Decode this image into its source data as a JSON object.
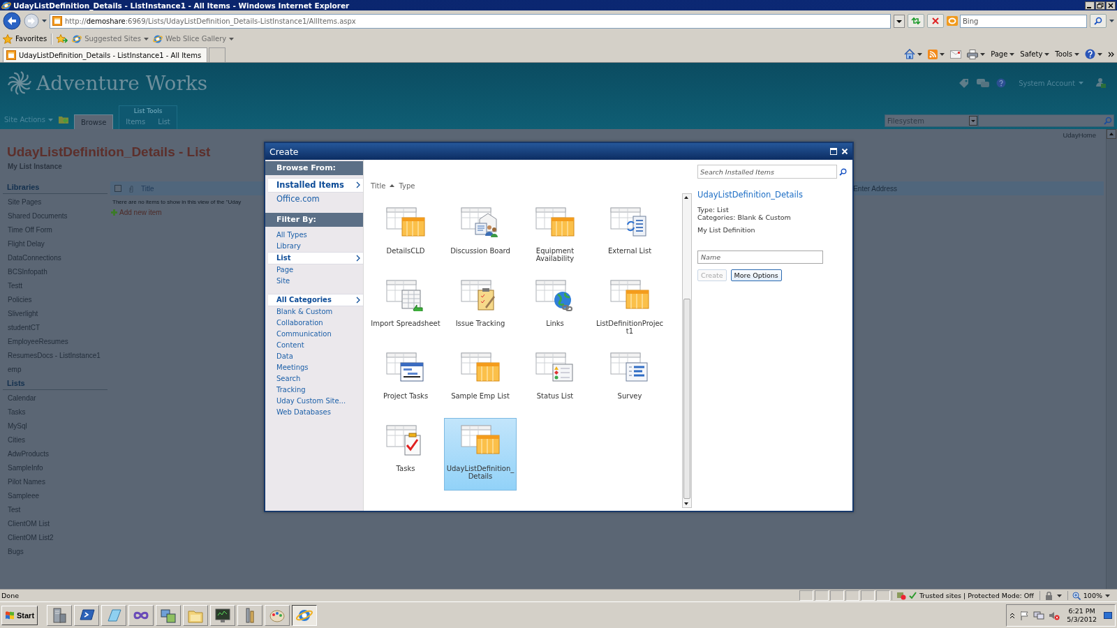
{
  "window": {
    "title": "UdayListDefinition_Details - ListInstance1 - All Items - Windows Internet Explorer"
  },
  "address_bar": {
    "url": "http://**demoshare**:6969/Lists/UdayListDefinition_Details-ListInstance1/AllItems.aspx",
    "search_placeholder": "Bing"
  },
  "favorites_bar": {
    "favorites": "Favorites",
    "links": [
      "Suggested Sites",
      "Web Slice Gallery"
    ]
  },
  "tabs": [
    {
      "label": "UdayListDefinition_Details - ListInstance1 - All Items",
      "selected": true
    }
  ],
  "command_bar": [
    "Page",
    "Safety",
    "Tools"
  ],
  "site": {
    "title": "Adventure Works",
    "user": "System Account",
    "search_scope": "Filesystem",
    "breadcrumb": "UdayHome"
  },
  "ribbon": {
    "site_actions": "Site Actions",
    "group_label": "List Tools",
    "tabs": [
      {
        "label": "Browse",
        "selected": true
      },
      {
        "label": "Items",
        "selected": false
      },
      {
        "label": "List",
        "selected": false
      }
    ]
  },
  "page": {
    "title": "UdayListDefinition_Details - List",
    "subtitle": "My List Instance"
  },
  "quick_launch": [
    {
      "heading": "Libraries",
      "items": [
        "Site Pages",
        "Shared Documents",
        "Time Off Form",
        "Flight Delay",
        "DataConnections",
        "BCSInfopath",
        "Testt",
        "Policies",
        "Sliverlight",
        "studentCT",
        "EmployeeResumes",
        "ResumesDocs - ListInstance1",
        "emp"
      ]
    },
    {
      "heading": "Lists",
      "items": [
        "Calendar",
        "Tasks",
        "MySql",
        "Cities",
        "AdwProducts",
        "SampleInfo",
        "Pilot Names",
        "Sampleee",
        "Test",
        "ClientOM List",
        "ClientOM List2",
        "Bugs"
      ]
    }
  ],
  "list_view": {
    "select_all": {
      "checked": false
    },
    "columns": [
      "Title",
      "Enter Address"
    ],
    "empty_message": "There are no items to show in this view of the \"Uday",
    "add_item": "Add new item"
  },
  "dialog": {
    "title": "Create",
    "browse_heading": "Browse From:",
    "sources": [
      {
        "label": "Installed Items",
        "selected": true
      },
      {
        "label": "Office.com",
        "selected": false
      }
    ],
    "filter_heading": "Filter By:",
    "types": [
      {
        "label": "All Types",
        "selected": false
      },
      {
        "label": "Library",
        "selected": false
      },
      {
        "label": "List",
        "selected": true
      },
      {
        "label": "Page",
        "selected": false
      },
      {
        "label": "Site",
        "selected": false
      }
    ],
    "categories": [
      {
        "label": "All Categories",
        "selected": true
      },
      {
        "label": "Blank & Custom",
        "selected": false
      },
      {
        "label": "Collaboration",
        "selected": false
      },
      {
        "label": "Communication",
        "selected": false
      },
      {
        "label": "Content",
        "selected": false
      },
      {
        "label": "Data",
        "selected": false
      },
      {
        "label": "Meetings",
        "selected": false
      },
      {
        "label": "Search",
        "selected": false
      },
      {
        "label": "Tracking",
        "selected": false
      },
      {
        "label": "Uday Custom Site...",
        "selected": false
      },
      {
        "label": "Web Databases",
        "selected": false
      }
    ],
    "sort_columns": [
      {
        "label": "Title",
        "sorted": true
      },
      {
        "label": "Type",
        "sorted": false
      }
    ],
    "templates": [
      {
        "label": "DetailsCLD",
        "kind": "grid",
        "selected": false
      },
      {
        "label": "Discussion Board",
        "kind": "discussion",
        "selected": false
      },
      {
        "label": "Equipment Availability",
        "kind": "grid",
        "selected": false
      },
      {
        "label": "External List",
        "kind": "external",
        "selected": false
      },
      {
        "label": "Import Spreadsheet",
        "kind": "spreadsheet",
        "selected": false
      },
      {
        "label": "Issue Tracking",
        "kind": "issue",
        "selected": false
      },
      {
        "label": "Links",
        "kind": "links",
        "selected": false
      },
      {
        "label": "ListDefinitionProject1",
        "kind": "grid",
        "selected": false
      },
      {
        "label": "Project Tasks",
        "kind": "project",
        "selected": false
      },
      {
        "label": "Sample Emp List",
        "kind": "grid",
        "selected": false
      },
      {
        "label": "Status List",
        "kind": "status",
        "selected": false
      },
      {
        "label": "Survey",
        "kind": "survey",
        "selected": false
      },
      {
        "label": "Tasks",
        "kind": "tasks",
        "selected": false
      },
      {
        "label": "UdayListDefinition_Details",
        "kind": "grid",
        "selected": true
      }
    ],
    "search_placeholder": "Search Installed Items",
    "details": {
      "title": "UdayListDefinition_Details",
      "type": "Type: List",
      "categories": "Categories: Blank & Custom",
      "description": "My List Definition",
      "name_placeholder": "Name",
      "buttons": [
        {
          "label": "Create",
          "disabled": true
        },
        {
          "label": "More Options",
          "disabled": false
        }
      ]
    }
  },
  "status_bar": {
    "text": "Done",
    "zone": "Trusted sites | Protected Mode: Off",
    "zoom": "100%"
  },
  "taskbar": {
    "start": "Start",
    "time": "6:21 PM",
    "date": "5/3/2012",
    "apps": [
      {
        "kind": "server",
        "selected": false
      },
      {
        "kind": "shell",
        "selected": false
      },
      {
        "kind": "notepad",
        "selected": false
      },
      {
        "kind": "infinity",
        "selected": false
      },
      {
        "kind": "network",
        "selected": false
      },
      {
        "kind": "folder",
        "selected": false
      },
      {
        "kind": "monitor",
        "selected": false
      },
      {
        "kind": "tools",
        "selected": false
      },
      {
        "kind": "paint",
        "selected": false
      },
      {
        "kind": "browser",
        "selected": true
      }
    ]
  }
}
